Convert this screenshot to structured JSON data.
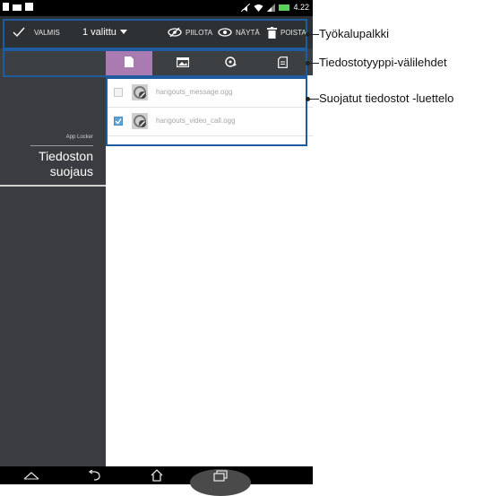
{
  "statusbar": {
    "time": "4.22",
    "left_icons": [
      "document-icon",
      "mail-icon",
      "bag-icon"
    ],
    "right_icons": [
      "no-sound-icon",
      "wifi-icon",
      "signal-icon",
      "battery-icon"
    ]
  },
  "toolbar": {
    "done_label": "VALMIS",
    "selected_label": "1 valittu",
    "hide_label": "PIILOTA",
    "show_label": "NÄYTÄ",
    "delete_label": "POISTA"
  },
  "tabs": [
    {
      "name": "documents",
      "icon": "document-icon",
      "active": true
    },
    {
      "name": "images",
      "icon": "image-icon",
      "active": false
    },
    {
      "name": "audio",
      "icon": "music-icon",
      "active": false
    },
    {
      "name": "other",
      "icon": "file-icon",
      "active": false
    }
  ],
  "left_pane": {
    "app_label": "App Locker",
    "section_title_line1": "Tiedoston",
    "section_title_line2": "suojaus"
  },
  "files": [
    {
      "name": "hangouts_message.ogg",
      "checked": false
    },
    {
      "name": "hangouts_video_call.ogg",
      "checked": true
    }
  ],
  "callouts": {
    "toolbar": "Työkalupalkki",
    "tabs": "Tiedostotyyppi-välilehdet",
    "list": "Suojatut tiedostot -luettelo"
  },
  "colors": {
    "toolbar_bg": "#2e3134",
    "active_tab": "#a97bb0",
    "highlight_border": "#1f5c9f",
    "checkbox_checked": "#5fa3d6"
  }
}
